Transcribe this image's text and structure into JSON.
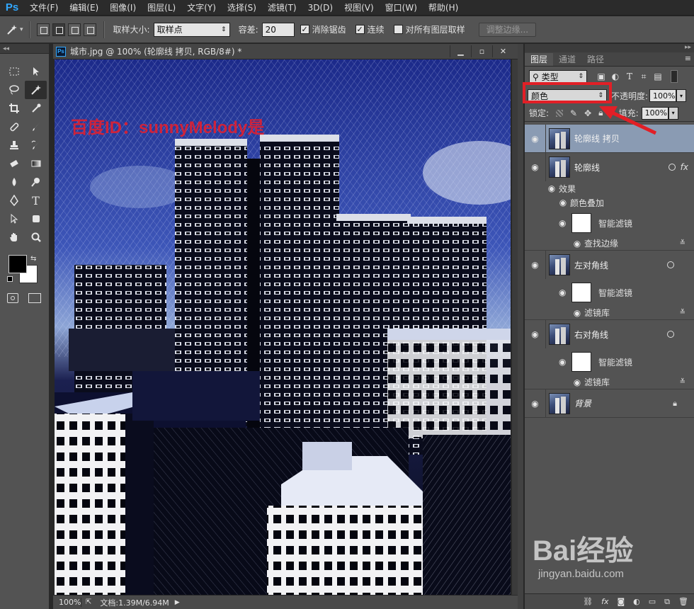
{
  "app": {
    "logo": "Ps"
  },
  "menu": [
    "文件(F)",
    "编辑(E)",
    "图像(I)",
    "图层(L)",
    "文字(Y)",
    "选择(S)",
    "滤镜(T)",
    "3D(D)",
    "视图(V)",
    "窗口(W)",
    "帮助(H)"
  ],
  "options": {
    "sample_size_label": "取样大小:",
    "sample_size_value": "取样点",
    "tolerance_label": "容差:",
    "tolerance_value": "20",
    "antialias_label": "消除锯齿",
    "contiguous_label": "连续",
    "all_layers_label": "对所有图层取样",
    "refine_edge_label": "调整边缘..."
  },
  "document": {
    "tab_title": "城市.jpg @ 100% (轮廓线 拷贝, RGB/8#) *",
    "zoom": "100%",
    "doc_size": "文档:1.39M/6.94M"
  },
  "watermark_text": "百度ID：sunnyMelody是",
  "panel": {
    "tabs": [
      "图层",
      "通道",
      "路径"
    ],
    "filter_kind": "类型",
    "blend_mode": "颜色",
    "opacity_label": "不透明度:",
    "opacity_value": "100%",
    "lock_label": "锁定:",
    "fill_label": "填充:",
    "fill_value": "100%"
  },
  "layers": [
    {
      "name": "轮廓线 拷贝"
    },
    {
      "name": "轮廓线"
    },
    {
      "name": "左对角线"
    },
    {
      "name": "右对角线"
    },
    {
      "name": "背景"
    }
  ],
  "sublayers": {
    "effects": "效果",
    "color_overlay": "颜色叠加",
    "smart_filter": "智能滤镜",
    "find_edges": "查找边缘",
    "filter_gallery": "滤镜库"
  },
  "baidu": {
    "brand": "Bai经验",
    "url": "jingyan.baidu.com"
  }
}
